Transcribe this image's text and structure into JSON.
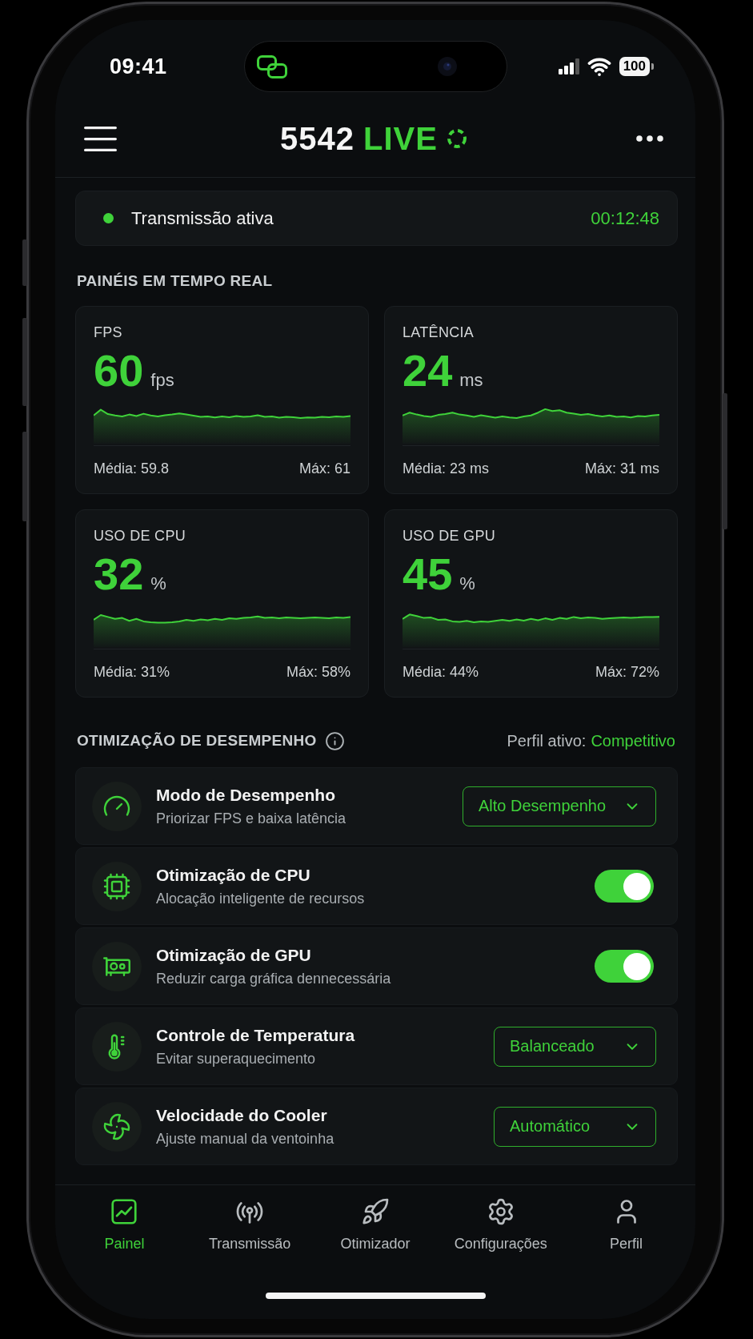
{
  "status_bar": {
    "time": "09:41",
    "battery": "100"
  },
  "header": {
    "title": "5542",
    "badge": "LIVE"
  },
  "stream_status": {
    "label": "Transmissão ativa",
    "active": true,
    "timer": "00:12:48"
  },
  "realtime_panels": {
    "title": "PAINÉIS EM TEMPO REAL",
    "panels": [
      {
        "label": "FPS",
        "value": "60",
        "unit": "fps",
        "average": "Média: 59.8",
        "max": "Máx: 61"
      },
      {
        "label": "LATÊNCIA",
        "value": "24",
        "unit": "ms",
        "average": "Média: 23 ms",
        "max": "Máx: 31 ms"
      },
      {
        "label": "USO DE CPU",
        "value": "32",
        "unit": "%",
        "average": "Média: 31%",
        "max": "Máx: 58%"
      },
      {
        "label": "USO DE GPU",
        "value": "45",
        "unit": "%",
        "average": "Média: 44%",
        "max": "Máx: 72%"
      }
    ]
  },
  "optimization": {
    "title": "OTIMIZAÇÃO DE DESEMPENHO",
    "profile_label": "Perfil ativo:",
    "profile_value": "Competitivo",
    "items": [
      {
        "kind": "select",
        "title": "Modo de Desempenho",
        "description": "Priorizar FPS e baixa latência",
        "value": "Alto Desempenho"
      },
      {
        "kind": "toggle",
        "title": "Otimização de CPU",
        "description": "Alocação inteligente de recursos",
        "on": true
      },
      {
        "kind": "toggle",
        "title": "Otimização de GPU",
        "description": "Reduzir carga gráfica dennecessária",
        "on": true
      },
      {
        "kind": "select",
        "title": "Controle de Temperatura",
        "description": "Evitar superaquecimento",
        "value": "Balanceado"
      },
      {
        "kind": "select",
        "title": "Velocidade do Cooler",
        "description": "Ajuste manual da ventoinha",
        "value": "Automático"
      }
    ]
  },
  "tab_bar": {
    "items": [
      {
        "label": "Painel",
        "selected": true
      },
      {
        "label": "Transmissão",
        "selected": false
      },
      {
        "label": "Otimizador",
        "selected": false
      },
      {
        "label": "Configurações",
        "selected": false
      },
      {
        "label": "Perfil",
        "selected": false
      }
    ]
  }
}
